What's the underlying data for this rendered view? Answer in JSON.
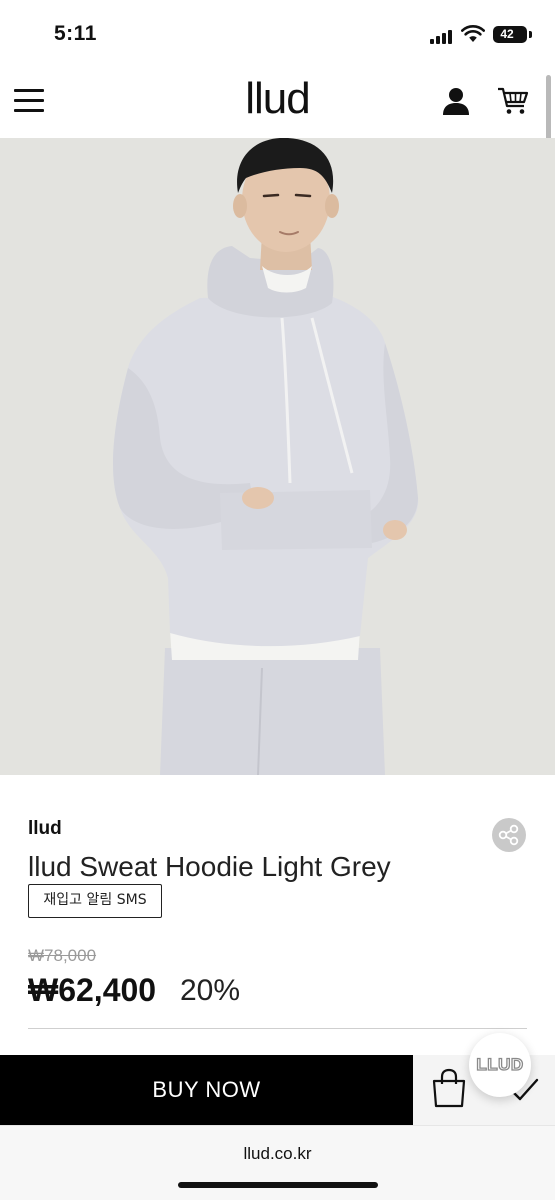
{
  "status_bar": {
    "time": "5:11",
    "battery": "42",
    "icons": [
      "cellular-signal-icon",
      "wifi-icon",
      "battery-icon"
    ]
  },
  "header": {
    "logo": "llud",
    "icons": [
      "menu-icon",
      "user-icon",
      "cart-icon"
    ]
  },
  "hero": {
    "colors": {
      "background": "#e3e3df",
      "garment": "#dcdde4",
      "hair": "#1b1b1b",
      "skin": "#e4c6ad"
    }
  },
  "product": {
    "brand": "llud",
    "name": "llud Sweat Hoodie Light Grey",
    "restock_label": "재입고 알림 SMS",
    "original_price": "₩78,000",
    "sale_price": "₩62,400",
    "discount": "20%",
    "share_icon": "share-icon"
  },
  "actions": {
    "buy_now_label": "BUY NOW",
    "bag_icon": "shopping-bag-icon",
    "check_icon": "check-icon",
    "floating_badge": "LLUD",
    "colors": {
      "buy_background": "#000000",
      "side_background": "#f4f4f4"
    }
  },
  "browser": {
    "url": "llud.co.kr"
  }
}
